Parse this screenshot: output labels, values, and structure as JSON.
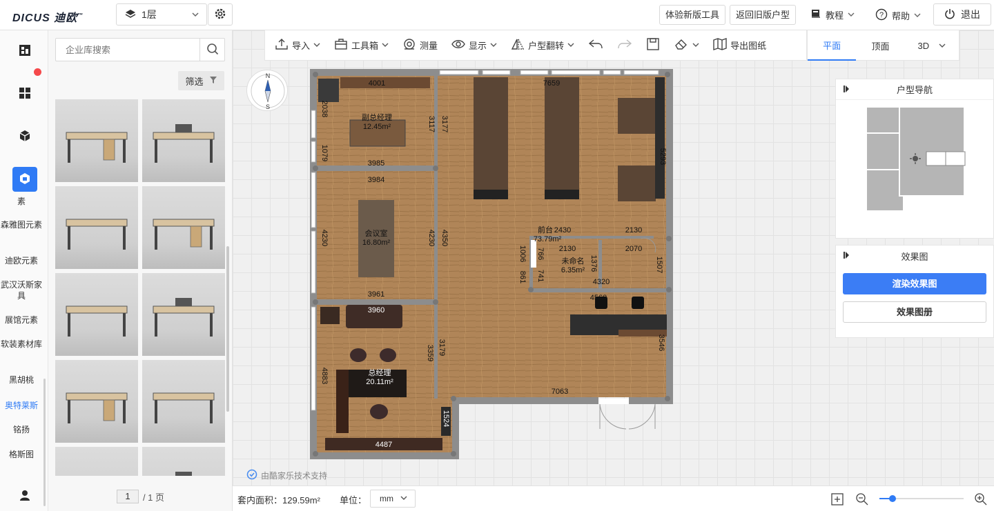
{
  "app": {
    "logo_text": "DICUS 迪欧",
    "logo_tm": "™"
  },
  "header": {
    "floor": "1层",
    "try_new_tool": "体验新版工具",
    "back_old": "返回旧版户型",
    "tutorial": "教程",
    "help": "帮助",
    "exit": "退出"
  },
  "left_rail": {
    "categories": [
      "素",
      "森雅图元素",
      "迪欧元素",
      "武汉沃斯家具",
      "展馆元素",
      "软装素材库",
      "黑胡桃",
      "奥特莱斯",
      "铭扬",
      "格斯图"
    ],
    "active_category": "奥特莱斯"
  },
  "library": {
    "search_placeholder": "企业库搜索",
    "filter_label": "筛选",
    "page_current": "1",
    "page_total": "/ 1 页"
  },
  "toolbar": {
    "import": "导入",
    "toolbox": "工具箱",
    "measure": "测量",
    "display": "显示",
    "flip": "户型翻转",
    "export": "导出图纸"
  },
  "view_tabs": {
    "plan": "平面",
    "top": "顶面",
    "three_d": "3D",
    "active": "平面"
  },
  "compass": {
    "north": "N",
    "south": "S"
  },
  "floorplan": {
    "rooms": [
      {
        "name": "副总经理",
        "area": "12.45m²"
      },
      {
        "name": "会议室",
        "area": "16.80m²"
      },
      {
        "name": "总经理",
        "area": "20.11m²"
      },
      {
        "name": "前台",
        "area": "73.79m²"
      },
      {
        "name": "未命名",
        "area": "6.35m²"
      }
    ],
    "dimensions": {
      "d4001": "4001",
      "d7659": "7659",
      "d2038": "2038",
      "d1079": "1079",
      "d3117": "3117",
      "d3177": "3177",
      "d5293": "5293",
      "d3985": "3985",
      "d3984": "3984",
      "d4230a": "4230",
      "d4230b": "4230",
      "d4350": "4350",
      "d2430": "2430",
      "d2130a": "2130",
      "d2130b": "2130",
      "d2070": "2070",
      "d1006": "1006",
      "d766": "766",
      "d861": "861",
      "d741": "741",
      "d1376": "1376",
      "d1507": "1507",
      "d4320": "4320",
      "d3961": "3961",
      "d3960": "3960",
      "d4560": "4560",
      "d3179": "3179",
      "d3359": "3359",
      "d3546": "3546",
      "d4883": "4883",
      "d7063": "7063",
      "d1524": "1524",
      "d4487": "4487"
    }
  },
  "support_text": "由酷家乐技术支持",
  "nav_panel": {
    "title": "户型导航"
  },
  "effect_panel": {
    "title": "效果图",
    "render": "渲染效果图",
    "album": "效果图册"
  },
  "statusbar": {
    "area_label": "套内面积：129.59m²",
    "unit_label": "单位：",
    "unit_value": "mm"
  },
  "colors": {
    "accent": "#2f7bf5",
    "floor": "#b48a5a",
    "wall": "#8d8d8d",
    "furniture": "#5e4634"
  }
}
